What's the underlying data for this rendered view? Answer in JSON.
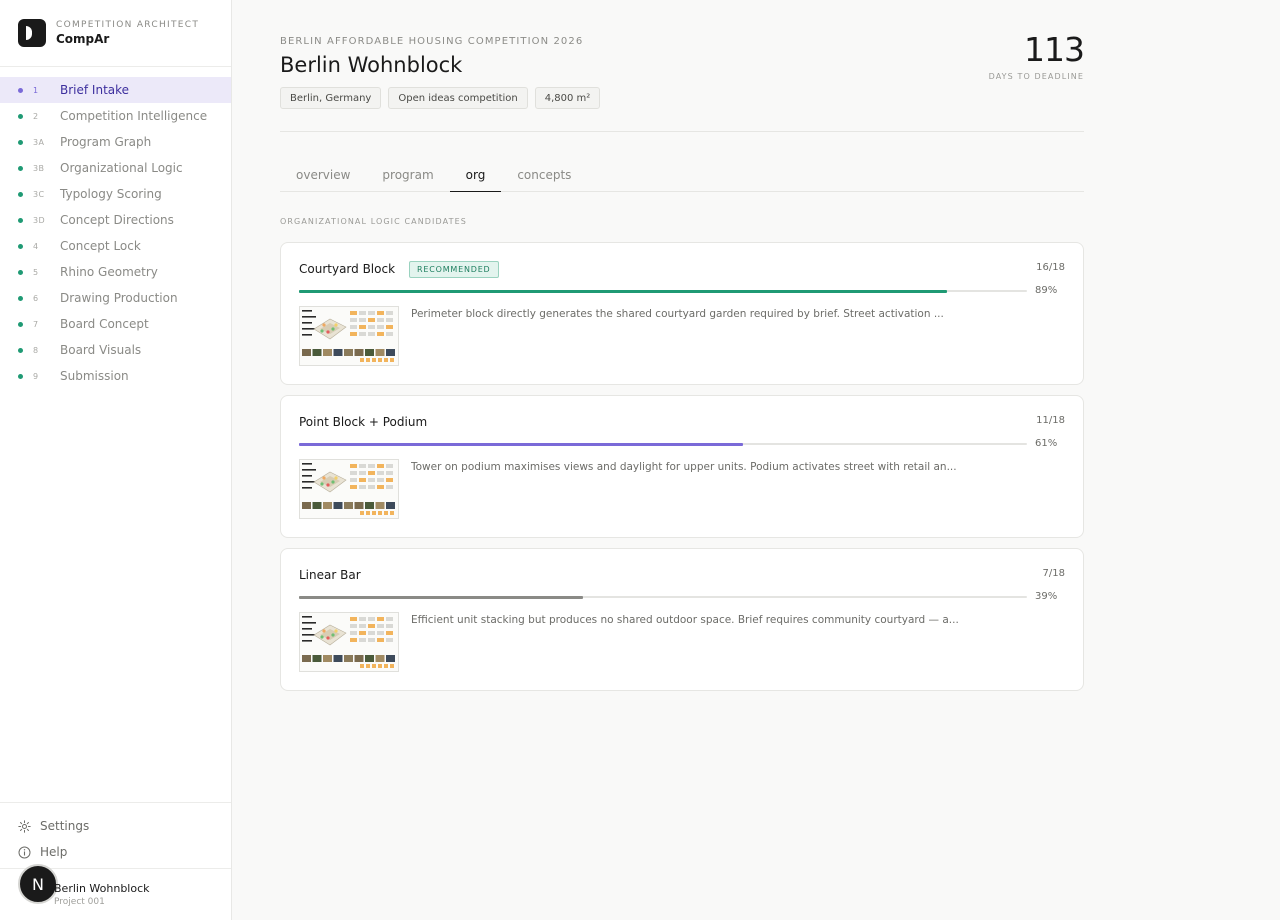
{
  "brand": {
    "subtitle": "COMPETITION ARCHITECT",
    "name": "CompAr"
  },
  "nav": [
    {
      "num": "1",
      "label": "Brief Intake",
      "active": true
    },
    {
      "num": "2",
      "label": "Competition Intelligence"
    },
    {
      "num": "3A",
      "label": "Program Graph"
    },
    {
      "num": "3B",
      "label": "Organizational Logic"
    },
    {
      "num": "3C",
      "label": "Typology Scoring"
    },
    {
      "num": "3D",
      "label": "Concept Directions"
    },
    {
      "num": "4",
      "label": "Concept Lock"
    },
    {
      "num": "5",
      "label": "Rhino Geometry"
    },
    {
      "num": "6",
      "label": "Drawing Production"
    },
    {
      "num": "7",
      "label": "Board Concept"
    },
    {
      "num": "8",
      "label": "Board Visuals"
    },
    {
      "num": "9",
      "label": "Submission"
    }
  ],
  "footer": {
    "settings": "Settings",
    "help": "Help"
  },
  "project": {
    "avatar": "N",
    "name": "Berlin Wohnblock",
    "id": "Project 001"
  },
  "header": {
    "kicker": "BERLIN AFFORDABLE HOUSING COMPETITION 2026",
    "title": "Berlin Wohnblock",
    "chips": [
      "Berlin, Germany",
      "Open ideas competition",
      "4,800 m²"
    ],
    "days": "113",
    "days_label": "DAYS TO DEADLINE"
  },
  "tabs": [
    {
      "label": "overview"
    },
    {
      "label": "program"
    },
    {
      "label": "org",
      "active": true
    },
    {
      "label": "concepts"
    }
  ],
  "section_label": "ORGANIZATIONAL LOGIC CANDIDATES",
  "candidates": [
    {
      "title": "Courtyard Block",
      "badge": "RECOMMENDED",
      "score": "16/18",
      "pct_label": "89%",
      "pct": 0.89,
      "color": "#1f9a74",
      "desc": "Perimeter block directly generates the shared courtyard garden required by brief. Street activation ..."
    },
    {
      "title": "Point Block + Podium",
      "score": "11/18",
      "pct_label": "61%",
      "pct": 0.61,
      "color": "#7a6ad8",
      "desc": "Tower on podium maximises views and daylight for upper units. Podium activates street with retail an..."
    },
    {
      "title": "Linear Bar",
      "score": "7/18",
      "pct_label": "39%",
      "pct": 0.39,
      "color": "#8a8a86",
      "desc": "Efficient unit stacking but produces no shared outdoor space. Brief requires community courtyard — a..."
    }
  ]
}
